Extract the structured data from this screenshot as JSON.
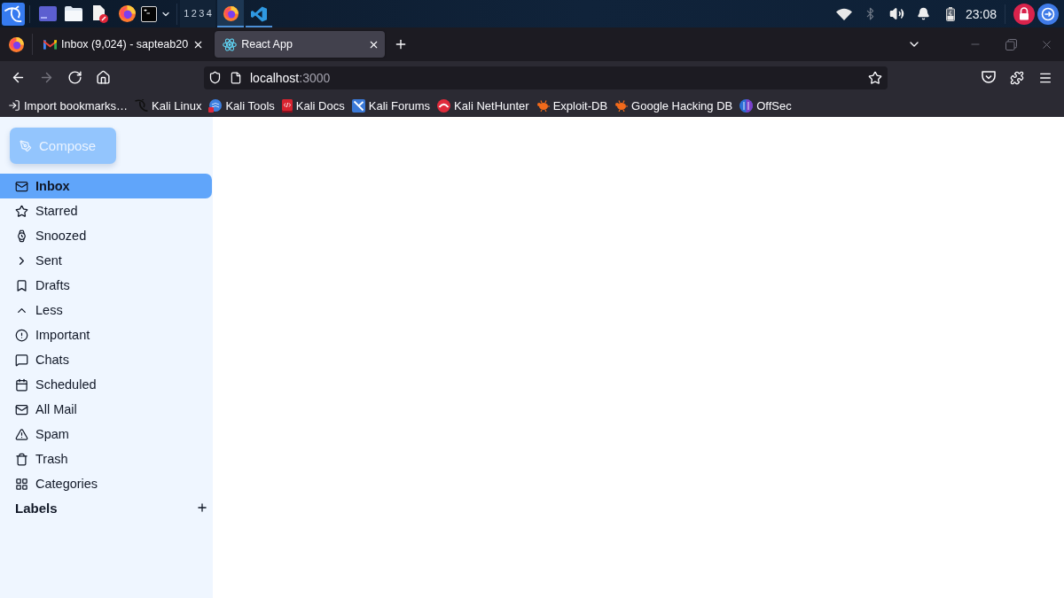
{
  "taskbar": {
    "workspaces": [
      "1",
      "2",
      "3",
      "4"
    ],
    "apps": [
      {
        "kind": "browser",
        "active": true
      },
      {
        "kind": "editor",
        "active": false
      }
    ],
    "clock": "23:08"
  },
  "browser": {
    "tabs": [
      {
        "kind": "mail",
        "title": "Inbox (9,024) - sapteab20",
        "selected": false
      },
      {
        "kind": "react",
        "title": "React App",
        "selected": true
      }
    ],
    "nav_buttons": [
      {
        "kind": "back",
        "disabled": false
      },
      {
        "kind": "forward",
        "disabled": true
      },
      {
        "kind": "reload",
        "disabled": false
      },
      {
        "kind": "home",
        "disabled": false
      }
    ],
    "address": {
      "host": "localhost",
      "port": ":3000"
    },
    "bookmarks": [
      {
        "kind": "import",
        "label": "Import bookmarks…"
      },
      {
        "kind": "dragon",
        "label": "Kali Linux"
      },
      {
        "kind": "tools",
        "label": "Kali Tools"
      },
      {
        "kind": "docs",
        "label": "Kali Docs"
      },
      {
        "kind": "forums",
        "label": "Kali Forums"
      },
      {
        "kind": "nethunter",
        "label": "Kali NetHunter"
      },
      {
        "kind": "bug",
        "label": "Exploit-DB"
      },
      {
        "kind": "bug",
        "label": "Google Hacking DB"
      },
      {
        "kind": "offsec",
        "label": "OffSec"
      }
    ]
  },
  "sidebar": {
    "compose": "Compose",
    "items": [
      {
        "kind": "inbox",
        "label": "Inbox",
        "selected": true
      },
      {
        "kind": "starred",
        "label": "Starred",
        "selected": false
      },
      {
        "kind": "snoozed",
        "label": "Snoozed",
        "selected": false
      },
      {
        "kind": "sent",
        "label": "Sent",
        "selected": false
      },
      {
        "kind": "drafts",
        "label": "Drafts",
        "selected": false
      },
      {
        "kind": "less",
        "label": "Less",
        "selected": false
      },
      {
        "kind": "important",
        "label": "Important",
        "selected": false
      },
      {
        "kind": "chats",
        "label": "Chats",
        "selected": false
      },
      {
        "kind": "scheduled",
        "label": "Scheduled",
        "selected": false
      },
      {
        "kind": "allmail",
        "label": "All Mail",
        "selected": false
      },
      {
        "kind": "spam",
        "label": "Spam",
        "selected": false
      },
      {
        "kind": "trash",
        "label": "Trash",
        "selected": false
      },
      {
        "kind": "categories",
        "label": "Categories",
        "selected": false
      }
    ],
    "labels_title": "Labels"
  }
}
